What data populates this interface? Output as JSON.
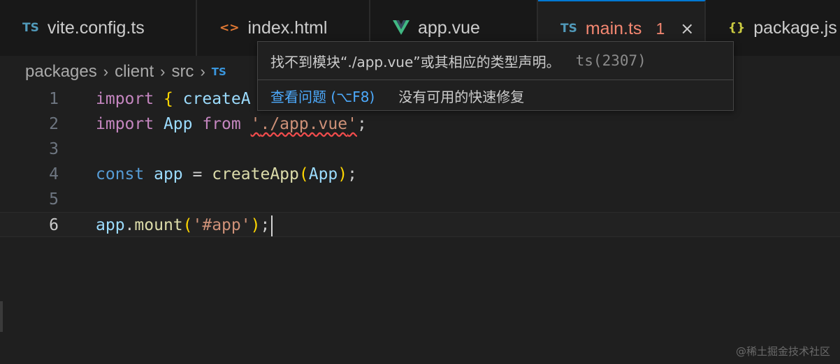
{
  "tabs": [
    {
      "icon": "TS",
      "icon_color": "#519aba",
      "label": "vite.config.ts"
    },
    {
      "icon": "<>",
      "icon_color": "#e37933",
      "label": "index.html"
    },
    {
      "icon": "vue-logo",
      "icon_color": "#41b883",
      "label": "app.vue"
    },
    {
      "icon": "TS",
      "icon_color": "#519aba",
      "label": "main.ts",
      "problem_count": "1",
      "close": "×",
      "active": true
    },
    {
      "icon": "{}",
      "icon_color": "#cbcb41",
      "label": "package.js"
    }
  ],
  "breadcrumb": {
    "items": [
      "packages",
      "client",
      "src"
    ],
    "file_icon": "TS"
  },
  "editor": {
    "current_line": 6,
    "lines": [
      {
        "n": "1",
        "kw": "import",
        "open": "{",
        "name": "createA"
      },
      {
        "n": "2",
        "kw": "import",
        "name": "App",
        "from": "from",
        "q1": "'",
        "path": "./app.vue",
        "q2": "'",
        "end": ";"
      },
      {
        "n": "3"
      },
      {
        "n": "4",
        "kw": "const",
        "name": "app",
        "eq": "=",
        "fn": "createApp",
        "op": "(",
        "arg": "App",
        "cp": ")",
        "end": ";"
      },
      {
        "n": "5"
      },
      {
        "n": "6",
        "obj": "app",
        "dot": ".",
        "fn": "mount",
        "op": "(",
        "str": "'#app'",
        "cp": ")",
        "end": ";"
      }
    ]
  },
  "hover": {
    "message": "找不到模块“./app.vue”或其相应的类型声明。",
    "code": "ts(2307)",
    "view_problem": "查看问题 (⌥F8)",
    "no_quick_fix": "没有可用的快速修复"
  },
  "watermark": "@稀土掘金技术社区",
  "colors": {
    "accent": "#0078d4",
    "error": "#f48771",
    "link": "#4daafc"
  }
}
